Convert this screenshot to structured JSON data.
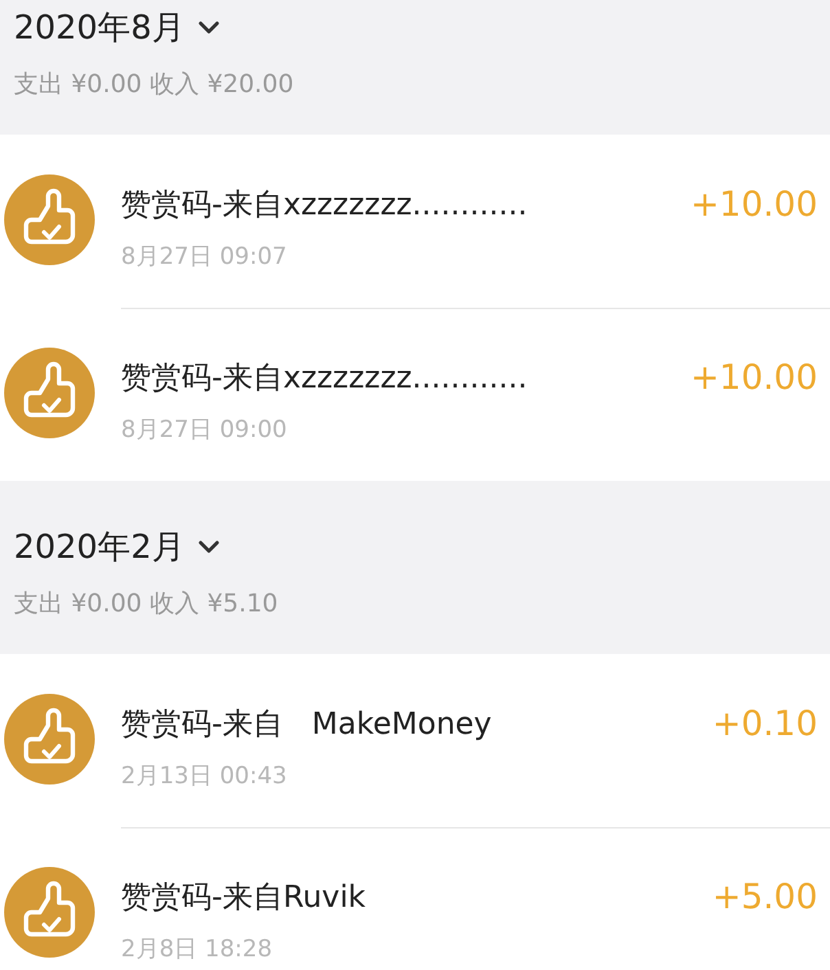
{
  "months": [
    {
      "title": "2020年8月",
      "summary": "支出 ¥0.00 收入 ¥20.00",
      "expanded": true,
      "items": [
        {
          "title": "赞赏码-来自xzzzzzzz............",
          "time": "8月27日 09:07",
          "amount": "+10.00"
        },
        {
          "title": "赞赏码-来自xzzzzzzz............",
          "time": "8月27日 09:00",
          "amount": "+10.00"
        }
      ]
    },
    {
      "title": "2020年2月",
      "summary": "支出 ¥0.00 收入 ¥5.10",
      "expanded": true,
      "items": [
        {
          "title": "赞赏码-来自   MakeMoney",
          "time": "2月13日 00:43",
          "amount": "+0.10"
        },
        {
          "title": "赞赏码-来自Ruvik",
          "time": "2月8日 18:28",
          "amount": "+5.00"
        }
      ]
    }
  ]
}
